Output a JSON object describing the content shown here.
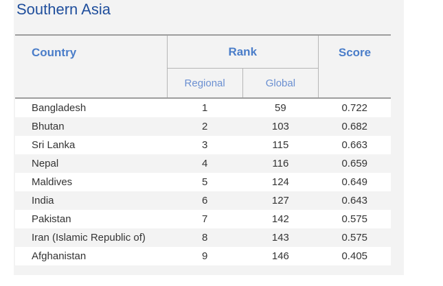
{
  "title": "Southern Asia",
  "headers": {
    "country": "Country",
    "rank": "Rank",
    "regional": "Regional",
    "global": "Global",
    "score": "Score"
  },
  "rows": [
    {
      "country": "Bangladesh",
      "regional": "1",
      "global": "59",
      "score": "0.722"
    },
    {
      "country": "Bhutan",
      "regional": "2",
      "global": "103",
      "score": "0.682"
    },
    {
      "country": "Sri Lanka",
      "regional": "3",
      "global": "115",
      "score": "0.663"
    },
    {
      "country": "Nepal",
      "regional": "4",
      "global": "116",
      "score": "0.659"
    },
    {
      "country": "Maldives",
      "regional": "5",
      "global": "124",
      "score": "0.649"
    },
    {
      "country": "India",
      "regional": "6",
      "global": "127",
      "score": "0.643"
    },
    {
      "country": "Pakistan",
      "regional": "7",
      "global": "142",
      "score": "0.575"
    },
    {
      "country": "Iran (Islamic Republic of)",
      "regional": "8",
      "global": "143",
      "score": "0.575"
    },
    {
      "country": "Afghanistan",
      "regional": "9",
      "global": "146",
      "score": "0.405"
    }
  ]
}
